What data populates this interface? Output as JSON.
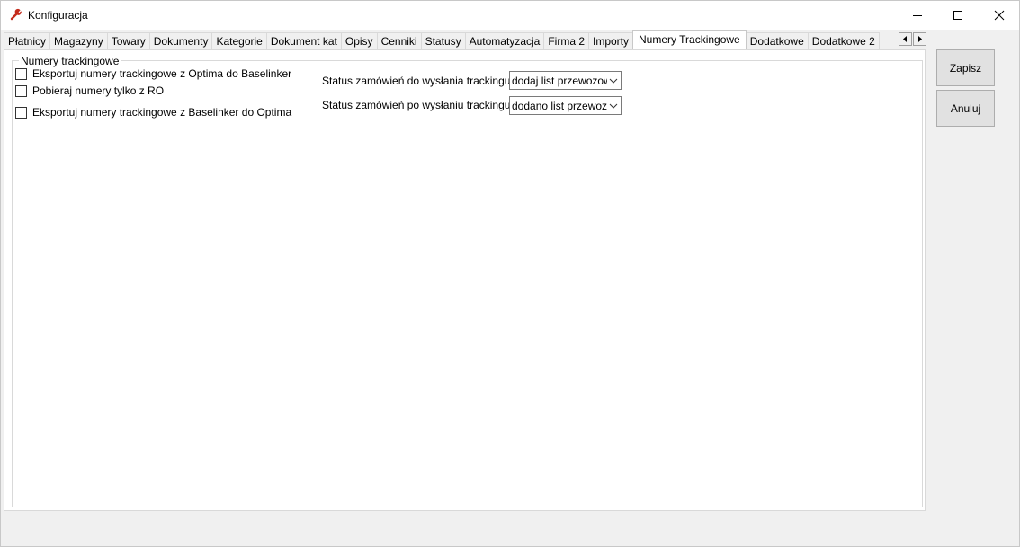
{
  "window": {
    "title": "Konfiguracja"
  },
  "tabs": [
    {
      "label": "Płatnicy"
    },
    {
      "label": "Magazyny"
    },
    {
      "label": "Towary"
    },
    {
      "label": "Dokumenty"
    },
    {
      "label": "Kategorie"
    },
    {
      "label": "Dokument kat"
    },
    {
      "label": "Opisy"
    },
    {
      "label": "Cenniki"
    },
    {
      "label": "Statusy"
    },
    {
      "label": "Automatyzacja"
    },
    {
      "label": "Firma 2"
    },
    {
      "label": "Importy"
    },
    {
      "label": "Numery Trackingowe"
    },
    {
      "label": "Dodatkowe"
    },
    {
      "label": "Dodatkowe 2"
    }
  ],
  "active_tab": "Numery Trackingowe",
  "group": {
    "title": "Numery trackingowe",
    "checkboxes": [
      {
        "label": "Eksportuj numery trackingowe z Optima do Baselinker",
        "checked": false
      },
      {
        "label": "Pobieraj numery tylko z RO",
        "checked": false
      },
      {
        "label": "Eksportuj numery trackingowe z Baselinker do Optima",
        "checked": false
      }
    ],
    "status_before": {
      "label": "Status zamówień do wysłania trackingu:",
      "value": "dodaj list przewozowy"
    },
    "status_after": {
      "label": "Status zamówień po wysłaniu trackingu:",
      "value": "dodano list przewozowy"
    }
  },
  "buttons": {
    "save": "Zapisz",
    "cancel": "Anuluj"
  },
  "colors": {
    "window_bg": "#f0f0f0",
    "panel_bg": "#ffffff",
    "button_bg": "#e1e1e1",
    "app_icon": "#c42b1c"
  }
}
